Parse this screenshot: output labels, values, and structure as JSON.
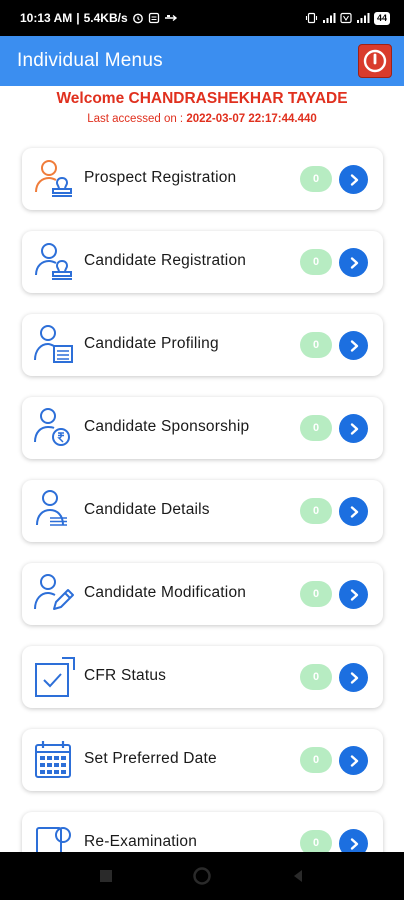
{
  "status_bar": {
    "time": "10:13 AM",
    "speed": "5.4KB/s",
    "battery": "44"
  },
  "app_bar": {
    "title": "Individual Menus"
  },
  "welcome": {
    "greeting": "Welcome CHANDRASHEKHAR TAYADE",
    "last_accessed_label": "Last accessed on : ",
    "last_accessed_value": "2022-03-07 22:17:44.440"
  },
  "colors": {
    "app_bar": "#3b8ef0",
    "accent_red": "#e0301e",
    "go_button": "#1c6fe0",
    "count_badge": "#b7ecc2"
  },
  "menu_items": [
    {
      "label": "Prospect Registration",
      "count": "0",
      "icon": "user-stamp-icon"
    },
    {
      "label": "Candidate Registration",
      "count": "0",
      "icon": "user-stamp-icon"
    },
    {
      "label": "Candidate Profiling",
      "count": "0",
      "icon": "user-profile-card-icon"
    },
    {
      "label": "Candidate Sponsorship",
      "count": "0",
      "icon": "user-rupee-icon"
    },
    {
      "label": "Candidate Details",
      "count": "0",
      "icon": "user-details-icon"
    },
    {
      "label": "Candidate Modification",
      "count": "0",
      "icon": "user-edit-icon"
    },
    {
      "label": "CFR Status",
      "count": "0",
      "icon": "checkbox-status-icon"
    },
    {
      "label": "Set Preferred Date",
      "count": "0",
      "icon": "calendar-icon"
    },
    {
      "label": "Re-Examination",
      "count": "0",
      "icon": "re-exam-icon"
    }
  ]
}
